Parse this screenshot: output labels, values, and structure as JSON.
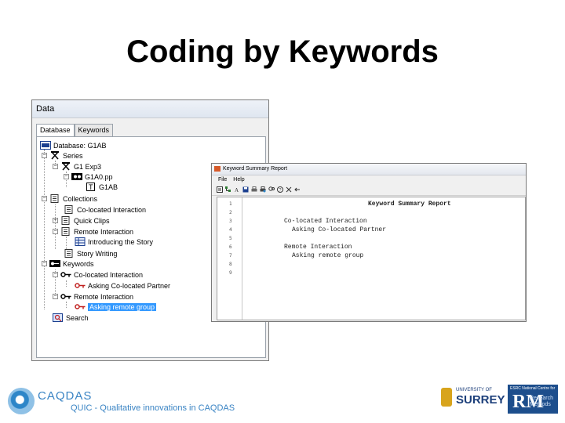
{
  "slide": {
    "title": "Coding by Keywords"
  },
  "data_window": {
    "title": "Data",
    "tabs": [
      "Database",
      "Keywords"
    ],
    "tree": [
      {
        "label": "Database: G1AB"
      },
      {
        "label": "Series"
      },
      {
        "label": "G1 Exp3"
      },
      {
        "label": "G1A0.pp"
      },
      {
        "label": "G1AB"
      },
      {
        "label": "Collections"
      },
      {
        "label": "Co-located Interaction"
      },
      {
        "label": "Quick Clips"
      },
      {
        "label": "Remote Interaction"
      },
      {
        "label": "Introducing the Story"
      },
      {
        "label": "Story Writing"
      },
      {
        "label": "Keywords"
      },
      {
        "label": "Co-located Interaction"
      },
      {
        "label": "Asking Co-located Partner"
      },
      {
        "label": "Remote Interaction"
      },
      {
        "label": "Asking remote group"
      },
      {
        "label": "Search"
      }
    ]
  },
  "summary_window": {
    "title": "Keyword Summary Report",
    "menu": [
      "File",
      "Help"
    ],
    "line_numbers": [
      "1",
      "2",
      "3",
      "4",
      "5",
      "6",
      "7",
      "8",
      "9"
    ],
    "lines": [
      "Keyword Summary Report",
      "",
      "Co-located Interaction",
      "Asking Co-located Partner",
      "",
      "Remote Interaction",
      "Asking remote group",
      "",
      ""
    ]
  },
  "footer": {
    "caqdas_name": "CAQDAS",
    "caqdas_tagline": "QUIC - Qualitative innovations in CAQDAS",
    "surrey_small": "UNIVERSITY OF",
    "surrey_big": "SURREY",
    "ncrm_top": "ESRC National Centre for",
    "ncrm_letters": "RM",
    "ncrm_side": [
      "Research",
      "Methods"
    ]
  },
  "colors": {
    "selection": "#3399ff",
    "keyword_icon": "#c0201f",
    "caqdas_blue": "#3a84c4",
    "surrey_blue": "#1c3f7a",
    "ncrm_blue": "#1d4e8c"
  }
}
